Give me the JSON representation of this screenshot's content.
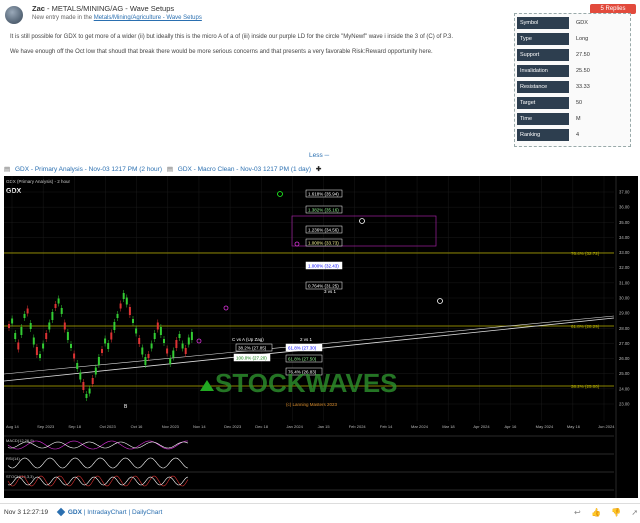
{
  "post": {
    "author": "Zac",
    "title_sep": "-",
    "category": "METALS/MINING/AG - Wave Setups",
    "subline_prefix": "New entry made in the",
    "subline_link": "Metals/Mining/Agriculture - Wave Setups",
    "replies_label": "5 Replies",
    "para1": "It is still possible for GDX to get more of a wider (ii) but ideally this is the micro A of a of (iii) inside our purple LD for the circle \"MyNewf\" wave i inside the 3 of (C) of P.3.",
    "para2": "We have enough off the Oct low that shoudl that break there would be more serious concerns and that presents a very favorable Risk:Reward opportunity here."
  },
  "info": [
    {
      "key": "Symbol",
      "value": "GDX"
    },
    {
      "key": "Type",
      "value": "Long"
    },
    {
      "key": "Support",
      "value": "27.50"
    },
    {
      "key": "Invalidation",
      "value": "25.50"
    },
    {
      "key": "Resistance",
      "value": "33.33"
    },
    {
      "key": "Target",
      "value": "50"
    },
    {
      "key": "Time",
      "value": "M"
    },
    {
      "key": "Ranking",
      "value": "4"
    }
  ],
  "less_label": "Less",
  "chart_links": {
    "primary": "GDX - Primary Analysis - Nov-03 1217 PM (2 hour)",
    "macro": "GDX - Macro Clean - Nov-03 1217 PM (1 day)"
  },
  "chart": {
    "symbol_label": "GDX",
    "header_text": "GDX (Primary Analysis) - 2 hour",
    "watermark": "STOCKWAVES",
    "copyright": "(c) Lanning Masters 2023",
    "x_ticks": [
      "Aug 14",
      "Sep 2023",
      "Sep 18",
      "Oct 2023",
      "Oct 16",
      "Nov 2023",
      "Nov 14",
      "Dec 2023",
      "Dec 18",
      "Jan 2024",
      "Jan 15",
      "Feb 2024",
      "Feb 14",
      "Mar 2024",
      "Mar 18",
      "Apr 2024",
      "Apr 16",
      "May 2024",
      "May 16",
      "Jun 2024"
    ],
    "y_ticks": [
      "37.00",
      "36.00",
      "35.00",
      "34.00",
      "33.00",
      "32.00",
      "31.00",
      "30.00",
      "29.00",
      "28.00",
      "27.00",
      "26.00",
      "25.00",
      "24.00",
      "23.00"
    ],
    "fib_boxes": [
      {
        "label": "1.618% (35.94)"
      },
      {
        "label": "1.382% (35.16)"
      },
      {
        "label": "1.236% (34.56)"
      },
      {
        "label": "1.000% (33.73)"
      },
      {
        "label": "1.000% (32.43)"
      },
      {
        "label": "0.764% (31.25)"
      }
    ],
    "lower_boxes": [
      {
        "label": "38.2% (27.85)"
      },
      {
        "label": "61.8% (27.30)"
      },
      {
        "label": "100.0% (27.20)"
      },
      {
        "label": "61.8% (27.50)"
      },
      {
        "label": "76.4% (26.83)"
      }
    ],
    "right_labels": {
      "r1": "76.4% (32.72)",
      "r2": "61.8% (28.29)",
      "r3": "38.2% (25.00)"
    },
    "wave_labels": {
      "cvsa": "C vs A (Up Zag)",
      "w2vs1": "2 vs 1",
      "w3vs1": "3 vs 1"
    },
    "indicators": [
      "MACD(12,26,9)",
      "RSI(14)",
      "STOCH(14,3,3)"
    ]
  },
  "footer": {
    "timestamp": "Nov 3 12:27:19",
    "tag_gdx": "GDX",
    "tag_intraday": "IntradayChart",
    "tag_daily": "DailyChart"
  }
}
